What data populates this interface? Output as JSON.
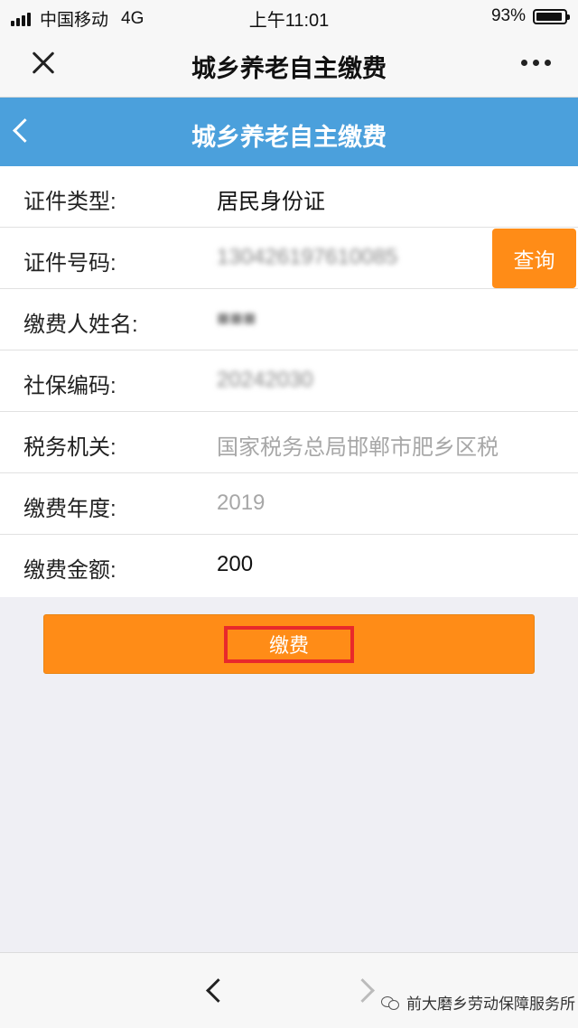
{
  "status_bar": {
    "carrier": "中国移动",
    "network": "4G",
    "time": "上午11:01",
    "battery": "93%",
    "battery_level": 0.93
  },
  "wechat_nav": {
    "title": "城乡养老自主缴费",
    "close_icon": "close-icon",
    "more_icon": "more-icon"
  },
  "header": {
    "title": "城乡养老自主缴费",
    "back_icon": "chevron-left-icon",
    "background_color": "#4ba0dc"
  },
  "form": {
    "id_type_label": "证件类型:",
    "id_type_value": "居民身份证",
    "id_number_label": "证件号码:",
    "id_number_value": "130426197610085",
    "query_button": "查询",
    "payer_name_label": "缴费人姓名:",
    "payer_name_value": "■■■",
    "social_code_label": "社保编码:",
    "social_code_value": "20242030",
    "tax_office_label": "税务机关:",
    "tax_office_value": "国家税务总局邯郸市肥乡区税",
    "year_label": "缴费年度:",
    "year_value": "2019",
    "amount_label": "缴费金额:",
    "amount_value": "200"
  },
  "actions": {
    "pay_button": "缴费",
    "accent_color": "#ff8c17",
    "highlight_color": "#e8292b"
  },
  "bottom_bar": {
    "back_icon": "chevron-left-icon",
    "forward_icon": "chevron-right-icon",
    "watermark": "前大磨乡劳动保障服务所"
  }
}
